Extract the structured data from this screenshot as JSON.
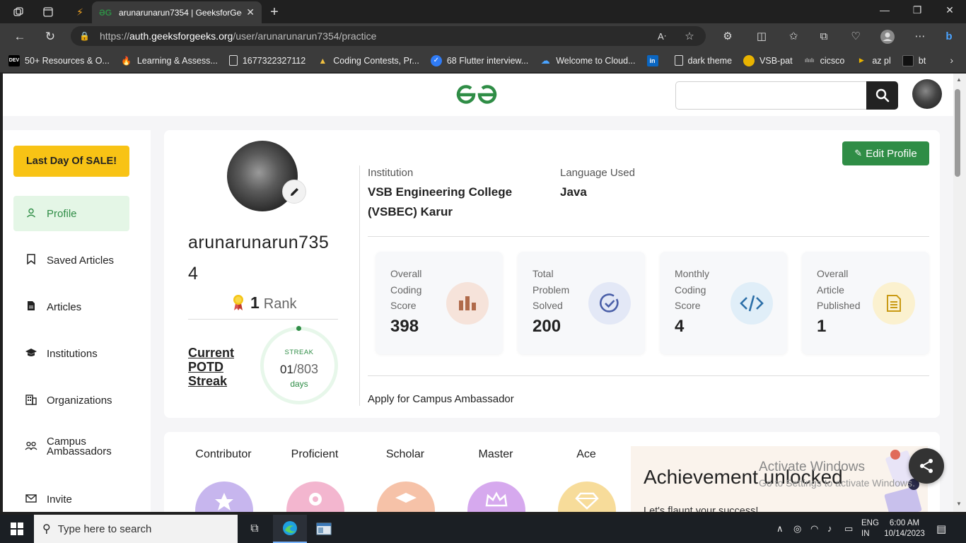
{
  "browser": {
    "tab_title": "arunarunarun7354 | GeeksforGee",
    "url_prefix": "https://",
    "url_domain": "auth.geeksforgeeks.org",
    "url_path": "/user/arunarunarun7354/practice",
    "bookmarks": [
      {
        "icon_text": "DEV",
        "icon_bg": "#000000",
        "label": "50+ Resources & O..."
      },
      {
        "icon_text": "",
        "icon_bg": "#f5a623",
        "label": "Learning & Assess..."
      },
      {
        "icon_text": "",
        "icon_bg": "transparent",
        "label": "1677322327112"
      },
      {
        "icon_text": "",
        "icon_bg": "transparent",
        "label": "Coding Contests, Pr..."
      },
      {
        "icon_text": "✓",
        "icon_bg": "#2f7bf5",
        "label": "68 Flutter interview..."
      },
      {
        "icon_text": "",
        "icon_bg": "transparent",
        "label": "Welcome to Cloud..."
      },
      {
        "icon_text": "in",
        "icon_bg": "#0a66c2",
        "label": ""
      },
      {
        "icon_text": "",
        "icon_bg": "transparent",
        "label": "dark theme"
      },
      {
        "icon_text": "",
        "icon_bg": "#e8b300",
        "label": "VSB-pat"
      },
      {
        "icon_text": "",
        "icon_bg": "transparent",
        "label": "cicsco"
      },
      {
        "icon_text": "",
        "icon_bg": "transparent",
        "label": "az pl"
      },
      {
        "icon_text": "",
        "icon_bg": "#111111",
        "label": "bt"
      }
    ]
  },
  "header": {
    "search_placeholder": ""
  },
  "sidebar": {
    "sale_label": "Last Day Of SALE!",
    "items": [
      {
        "label": "Profile",
        "icon": "user-icon"
      },
      {
        "label": "Saved Articles",
        "icon": "bookmark-icon"
      },
      {
        "label": "Articles",
        "icon": "document-icon"
      },
      {
        "label": "Institutions",
        "icon": "graduation-cap-icon"
      },
      {
        "label": "Organizations",
        "icon": "building-icon"
      },
      {
        "label": "Campus Ambassadors",
        "icon": "people-icon"
      },
      {
        "label": "Invite",
        "icon": "mail-icon"
      }
    ]
  },
  "profile": {
    "username": "arunarunarun7354",
    "rank_number": "1",
    "rank_label": "Rank",
    "potd_label": "Current POTD Streak",
    "streak_title": "STREAK",
    "streak_current": "01",
    "streak_total": "/803",
    "streak_unit": "days",
    "edit_label": "Edit Profile",
    "institution_label": "Institution",
    "institution_value": "VSB Engineering College (VSBEC) Karur",
    "language_label": "Language Used",
    "language_value": "Java",
    "campus_apply": "Apply for Campus Ambassador"
  },
  "stats": [
    {
      "label": "Overall Coding Score",
      "value": "398",
      "icon": "bar-chart-icon",
      "icon_bg": "#f6e3da",
      "icon_color": "#b06a4a"
    },
    {
      "label": "Total Problem Solved",
      "value": "200",
      "icon": "check-circle-icon",
      "icon_bg": "#e3e8f6",
      "icon_color": "#4a5fa8"
    },
    {
      "label": "Monthly Coding Score",
      "value": "4",
      "icon": "code-icon",
      "icon_bg": "#e0eef8",
      "icon_color": "#2c6fa8"
    },
    {
      "label": "Overall Article Published",
      "value": "1",
      "icon": "article-icon",
      "icon_bg": "#fbf1cf",
      "icon_color": "#c99a14"
    }
  ],
  "badges": [
    {
      "name": "Contributor",
      "color": "#c7b6ee"
    },
    {
      "name": "Proficient",
      "color": "#f3b6cf"
    },
    {
      "name": "Scholar",
      "color": "#f6c2a8"
    },
    {
      "name": "Master",
      "color": "#d6a9ee"
    },
    {
      "name": "Ace",
      "color": "#f7dc9a"
    }
  ],
  "achievement": {
    "title": "Achievement unlocked",
    "subtitle": "Let's flaunt your success!"
  },
  "watermark": {
    "line1": "Activate Windows",
    "line2": "Go to Settings to activate Windows."
  },
  "taskbar": {
    "search_placeholder": "Type here to search",
    "lang1": "ENG",
    "lang2": "IN",
    "time": "6:00 AM",
    "date": "10/14/2023"
  }
}
